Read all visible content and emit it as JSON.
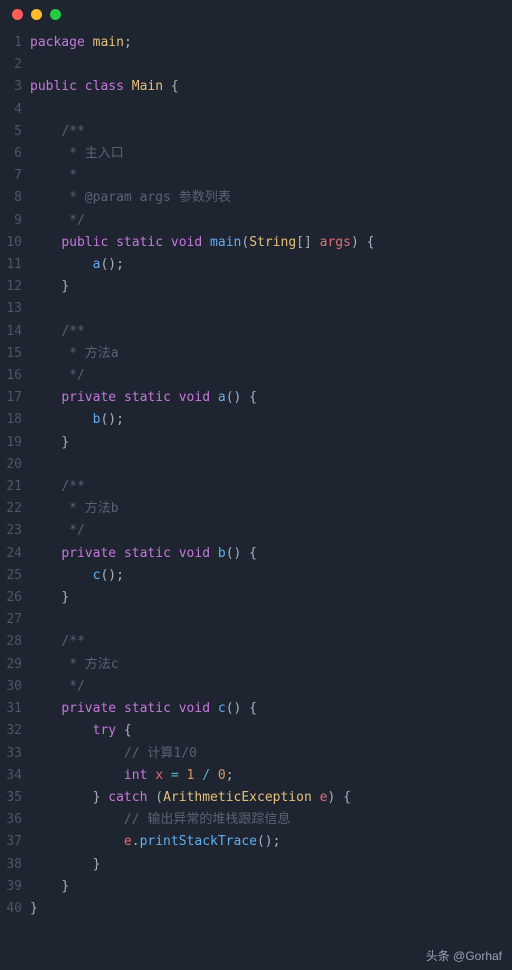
{
  "window": {
    "traffic_lights": [
      "close",
      "minimize",
      "zoom"
    ]
  },
  "caption": "头条 @Gorhaf",
  "code": {
    "lines": [
      {
        "n": "1",
        "tokens": [
          {
            "t": "package",
            "c": "kw"
          },
          {
            "t": " ",
            "c": ""
          },
          {
            "t": "main",
            "c": "type"
          },
          {
            "t": ";",
            "c": "punct"
          }
        ]
      },
      {
        "n": "2",
        "tokens": []
      },
      {
        "n": "3",
        "tokens": [
          {
            "t": "public",
            "c": "kw"
          },
          {
            "t": " ",
            "c": ""
          },
          {
            "t": "class",
            "c": "kw"
          },
          {
            "t": " ",
            "c": ""
          },
          {
            "t": "Main",
            "c": "type"
          },
          {
            "t": " {",
            "c": "punct"
          }
        ]
      },
      {
        "n": "4",
        "tokens": []
      },
      {
        "n": "5",
        "tokens": [
          {
            "t": "    ",
            "c": ""
          },
          {
            "t": "/**",
            "c": "comment"
          }
        ]
      },
      {
        "n": "6",
        "tokens": [
          {
            "t": "     ",
            "c": ""
          },
          {
            "t": "* 主入口",
            "c": "comment"
          }
        ]
      },
      {
        "n": "7",
        "tokens": [
          {
            "t": "     ",
            "c": ""
          },
          {
            "t": "*",
            "c": "comment"
          }
        ]
      },
      {
        "n": "8",
        "tokens": [
          {
            "t": "     ",
            "c": ""
          },
          {
            "t": "* @param args 参数列表",
            "c": "comment"
          }
        ]
      },
      {
        "n": "9",
        "tokens": [
          {
            "t": "     ",
            "c": ""
          },
          {
            "t": "*/",
            "c": "comment"
          }
        ]
      },
      {
        "n": "10",
        "tokens": [
          {
            "t": "    ",
            "c": ""
          },
          {
            "t": "public",
            "c": "kw"
          },
          {
            "t": " ",
            "c": ""
          },
          {
            "t": "static",
            "c": "kw"
          },
          {
            "t": " ",
            "c": ""
          },
          {
            "t": "void",
            "c": "kw"
          },
          {
            "t": " ",
            "c": ""
          },
          {
            "t": "main",
            "c": "fn"
          },
          {
            "t": "(",
            "c": "punct"
          },
          {
            "t": "String",
            "c": "type"
          },
          {
            "t": "[] ",
            "c": "punct"
          },
          {
            "t": "args",
            "c": "var"
          },
          {
            "t": ") {",
            "c": "punct"
          }
        ]
      },
      {
        "n": "11",
        "tokens": [
          {
            "t": "        ",
            "c": ""
          },
          {
            "t": "a",
            "c": "fn"
          },
          {
            "t": "();",
            "c": "punct"
          }
        ]
      },
      {
        "n": "12",
        "tokens": [
          {
            "t": "    ",
            "c": ""
          },
          {
            "t": "}",
            "c": "punct"
          }
        ]
      },
      {
        "n": "13",
        "tokens": []
      },
      {
        "n": "14",
        "tokens": [
          {
            "t": "    ",
            "c": ""
          },
          {
            "t": "/**",
            "c": "comment"
          }
        ]
      },
      {
        "n": "15",
        "tokens": [
          {
            "t": "     ",
            "c": ""
          },
          {
            "t": "* 方法a",
            "c": "comment"
          }
        ]
      },
      {
        "n": "16",
        "tokens": [
          {
            "t": "     ",
            "c": ""
          },
          {
            "t": "*/",
            "c": "comment"
          }
        ]
      },
      {
        "n": "17",
        "tokens": [
          {
            "t": "    ",
            "c": ""
          },
          {
            "t": "private",
            "c": "kw"
          },
          {
            "t": " ",
            "c": ""
          },
          {
            "t": "static",
            "c": "kw"
          },
          {
            "t": " ",
            "c": ""
          },
          {
            "t": "void",
            "c": "kw"
          },
          {
            "t": " ",
            "c": ""
          },
          {
            "t": "a",
            "c": "fn"
          },
          {
            "t": "() {",
            "c": "punct"
          }
        ]
      },
      {
        "n": "18",
        "tokens": [
          {
            "t": "        ",
            "c": ""
          },
          {
            "t": "b",
            "c": "fn"
          },
          {
            "t": "();",
            "c": "punct"
          }
        ]
      },
      {
        "n": "19",
        "tokens": [
          {
            "t": "    ",
            "c": ""
          },
          {
            "t": "}",
            "c": "punct"
          }
        ]
      },
      {
        "n": "20",
        "tokens": []
      },
      {
        "n": "21",
        "tokens": [
          {
            "t": "    ",
            "c": ""
          },
          {
            "t": "/**",
            "c": "comment"
          }
        ]
      },
      {
        "n": "22",
        "tokens": [
          {
            "t": "     ",
            "c": ""
          },
          {
            "t": "* 方法b",
            "c": "comment"
          }
        ]
      },
      {
        "n": "23",
        "tokens": [
          {
            "t": "     ",
            "c": ""
          },
          {
            "t": "*/",
            "c": "comment"
          }
        ]
      },
      {
        "n": "24",
        "tokens": [
          {
            "t": "    ",
            "c": ""
          },
          {
            "t": "private",
            "c": "kw"
          },
          {
            "t": " ",
            "c": ""
          },
          {
            "t": "static",
            "c": "kw"
          },
          {
            "t": " ",
            "c": ""
          },
          {
            "t": "void",
            "c": "kw"
          },
          {
            "t": " ",
            "c": ""
          },
          {
            "t": "b",
            "c": "fn"
          },
          {
            "t": "() {",
            "c": "punct"
          }
        ]
      },
      {
        "n": "25",
        "tokens": [
          {
            "t": "        ",
            "c": ""
          },
          {
            "t": "c",
            "c": "fn"
          },
          {
            "t": "();",
            "c": "punct"
          }
        ]
      },
      {
        "n": "26",
        "tokens": [
          {
            "t": "    ",
            "c": ""
          },
          {
            "t": "}",
            "c": "punct"
          }
        ]
      },
      {
        "n": "27",
        "tokens": []
      },
      {
        "n": "28",
        "tokens": [
          {
            "t": "    ",
            "c": ""
          },
          {
            "t": "/**",
            "c": "comment"
          }
        ]
      },
      {
        "n": "29",
        "tokens": [
          {
            "t": "     ",
            "c": ""
          },
          {
            "t": "* 方法c",
            "c": "comment"
          }
        ]
      },
      {
        "n": "30",
        "tokens": [
          {
            "t": "     ",
            "c": ""
          },
          {
            "t": "*/",
            "c": "comment"
          }
        ]
      },
      {
        "n": "31",
        "tokens": [
          {
            "t": "    ",
            "c": ""
          },
          {
            "t": "private",
            "c": "kw"
          },
          {
            "t": " ",
            "c": ""
          },
          {
            "t": "static",
            "c": "kw"
          },
          {
            "t": " ",
            "c": ""
          },
          {
            "t": "void",
            "c": "kw"
          },
          {
            "t": " ",
            "c": ""
          },
          {
            "t": "c",
            "c": "fn"
          },
          {
            "t": "() {",
            "c": "punct"
          }
        ]
      },
      {
        "n": "32",
        "tokens": [
          {
            "t": "        ",
            "c": ""
          },
          {
            "t": "try",
            "c": "kw"
          },
          {
            "t": " {",
            "c": "punct"
          }
        ]
      },
      {
        "n": "33",
        "tokens": [
          {
            "t": "            ",
            "c": ""
          },
          {
            "t": "// 计算1/0",
            "c": "comment"
          }
        ]
      },
      {
        "n": "34",
        "tokens": [
          {
            "t": "            ",
            "c": ""
          },
          {
            "t": "int",
            "c": "kw"
          },
          {
            "t": " ",
            "c": ""
          },
          {
            "t": "x",
            "c": "var"
          },
          {
            "t": " ",
            "c": ""
          },
          {
            "t": "=",
            "c": "op"
          },
          {
            "t": " ",
            "c": ""
          },
          {
            "t": "1",
            "c": "num-orange"
          },
          {
            "t": " ",
            "c": ""
          },
          {
            "t": "/",
            "c": "op"
          },
          {
            "t": " ",
            "c": ""
          },
          {
            "t": "0",
            "c": "num-orange"
          },
          {
            "t": ";",
            "c": "punct"
          }
        ]
      },
      {
        "n": "35",
        "tokens": [
          {
            "t": "        ",
            "c": ""
          },
          {
            "t": "}",
            "c": "punct"
          },
          {
            "t": " ",
            "c": ""
          },
          {
            "t": "catch",
            "c": "kw"
          },
          {
            "t": " (",
            "c": "punct"
          },
          {
            "t": "ArithmeticException",
            "c": "type"
          },
          {
            "t": " ",
            "c": ""
          },
          {
            "t": "e",
            "c": "var"
          },
          {
            "t": ") {",
            "c": "punct"
          }
        ]
      },
      {
        "n": "36",
        "tokens": [
          {
            "t": "            ",
            "c": ""
          },
          {
            "t": "// 输出异常的堆栈跟踪信息",
            "c": "comment"
          }
        ]
      },
      {
        "n": "37",
        "tokens": [
          {
            "t": "            ",
            "c": ""
          },
          {
            "t": "e",
            "c": "var"
          },
          {
            "t": ".",
            "c": "punct"
          },
          {
            "t": "printStackTrace",
            "c": "fn"
          },
          {
            "t": "();",
            "c": "punct"
          }
        ]
      },
      {
        "n": "38",
        "tokens": [
          {
            "t": "        ",
            "c": ""
          },
          {
            "t": "}",
            "c": "punct"
          }
        ]
      },
      {
        "n": "39",
        "tokens": [
          {
            "t": "    ",
            "c": ""
          },
          {
            "t": "}",
            "c": "punct"
          }
        ]
      },
      {
        "n": "40",
        "tokens": [
          {
            "t": "}",
            "c": "punct"
          }
        ]
      }
    ]
  }
}
